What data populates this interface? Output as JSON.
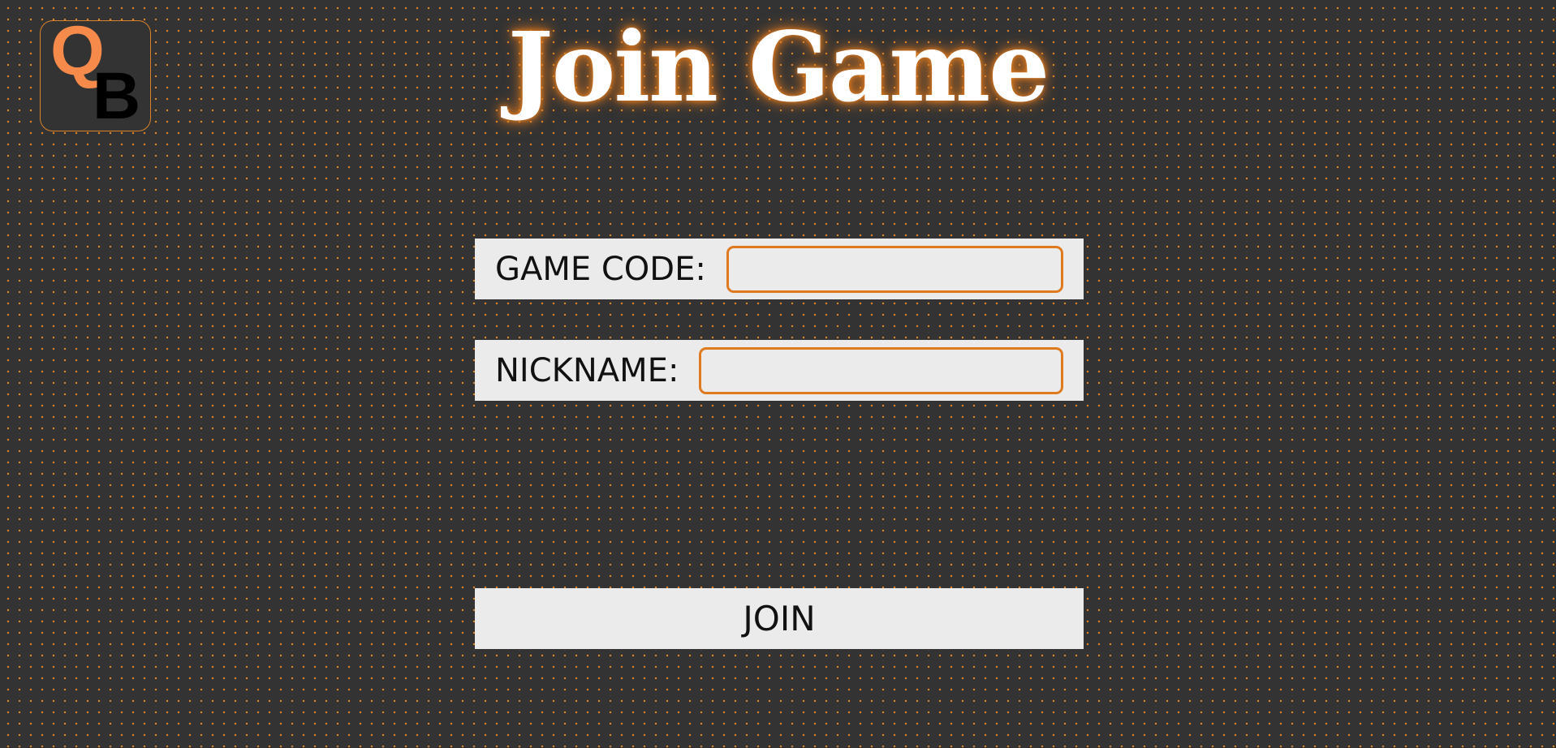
{
  "logo": {
    "letter_primary": "Q",
    "letter_secondary": "B"
  },
  "page": {
    "title": "Join Game"
  },
  "form": {
    "game_code": {
      "label": "GAME CODE:",
      "value": "",
      "placeholder": ""
    },
    "nickname": {
      "label": "NICKNAME:",
      "value": "",
      "placeholder": ""
    },
    "join_label": "JOIN"
  },
  "colors": {
    "background": "#333333",
    "dot_pattern": "#d9822b",
    "accent": "#e07a1f",
    "logo_q": "#f58a4b",
    "field_background": "#ebebeb",
    "title_text": "#ffffff"
  }
}
